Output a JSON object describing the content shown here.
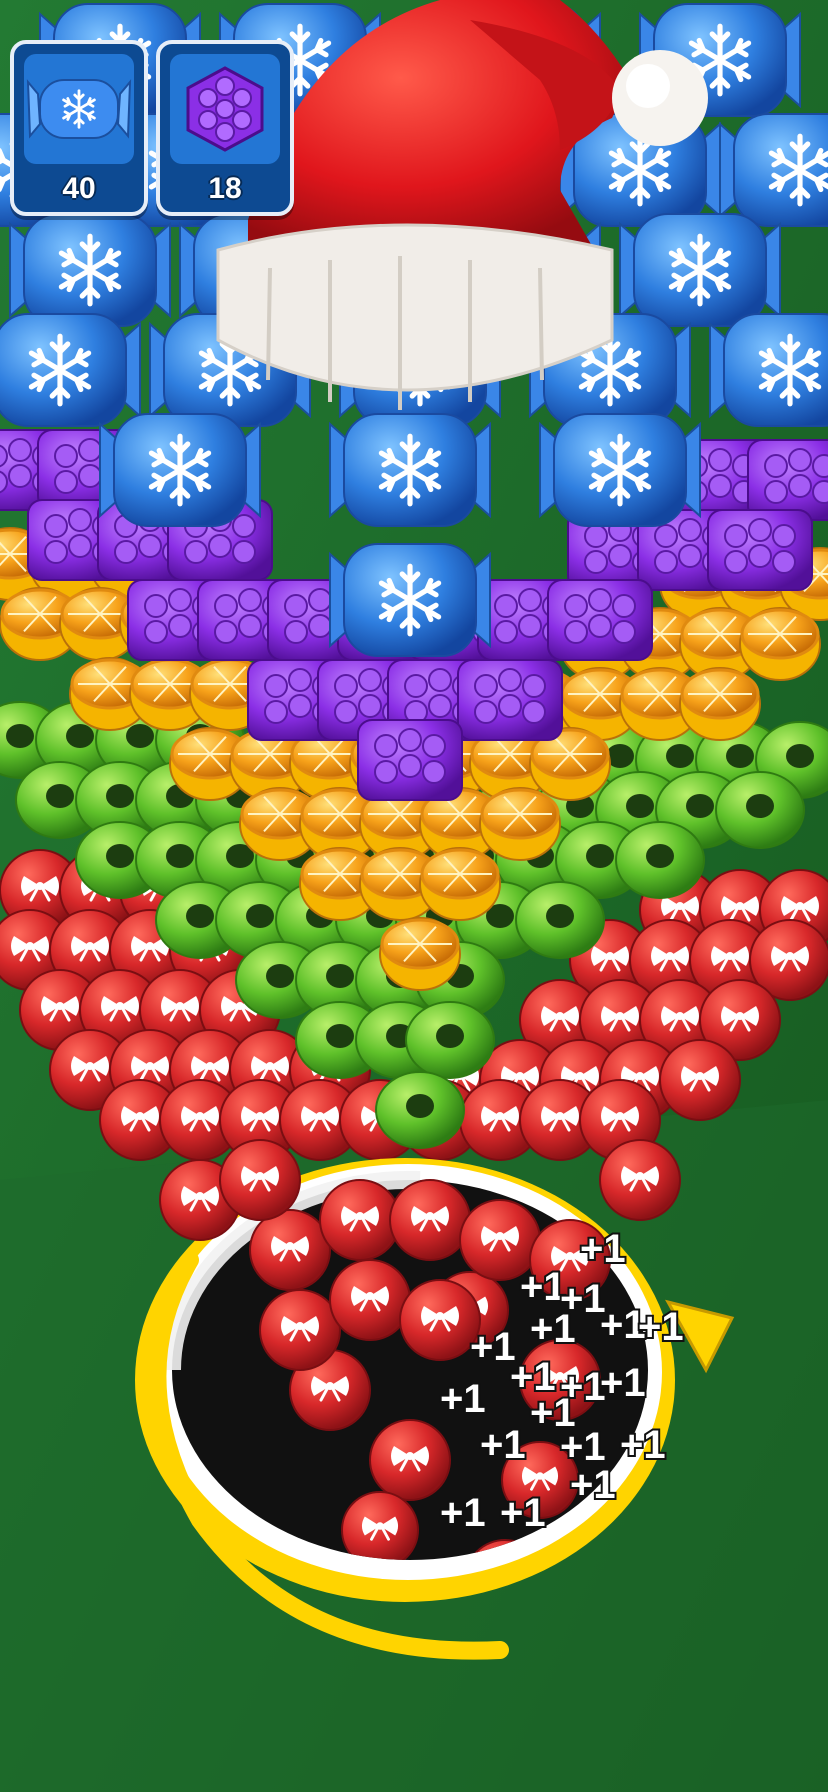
{
  "goals": [
    {
      "icon": "snowflake-candy-icon",
      "count": "40"
    },
    {
      "icon": "purple-block-icon",
      "count": "18"
    }
  ],
  "popups": [
    "+1",
    "+1",
    "+1",
    "+1",
    "+1",
    "+1",
    "+1",
    "+1",
    "+1",
    "+1",
    "+1",
    "+1",
    "+1",
    "+1",
    "+1",
    "+1",
    "+1",
    "+1"
  ],
  "colors": {
    "felt": "#1f6b2c",
    "candy_blue": "#2f7fe0",
    "block_purple": "#8b2fe6",
    "orange_slice": "#f7a21a",
    "donut_green": "#5fc12a",
    "ball_red": "#d8282a",
    "hat_red": "#e0161c",
    "hole_rim": "#ffd400"
  }
}
